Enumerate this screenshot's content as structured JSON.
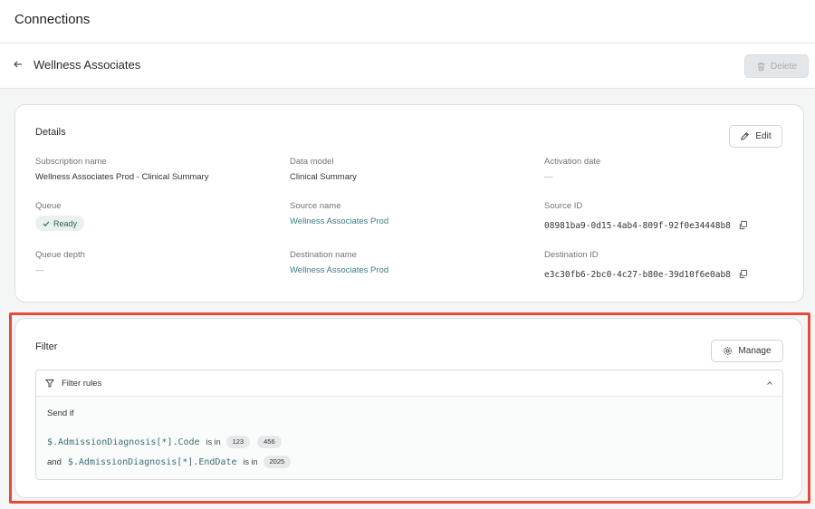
{
  "topbar": {
    "title": "Connections"
  },
  "header": {
    "name": "Wellness Associates",
    "delete_label": "Delete"
  },
  "details": {
    "title": "Details",
    "edit_label": "Edit",
    "subscription_name": {
      "label": "Subscription name",
      "value": "Wellness Associates Prod - Clinical Summary"
    },
    "data_model": {
      "label": "Data model",
      "value": "Clinical Summary"
    },
    "activation_date": {
      "label": "Activation date",
      "value": "—"
    },
    "queue": {
      "label": "Queue",
      "value": "Ready"
    },
    "source_name": {
      "label": "Source name",
      "value": "Wellness Associates Prod"
    },
    "source_id": {
      "label": "Source ID",
      "value": "08981ba9-0d15-4ab4-809f-92f0e34448b8"
    },
    "queue_depth": {
      "label": "Queue depth",
      "value": "—"
    },
    "destination_name": {
      "label": "Destination name",
      "value": "Wellness Associates Prod"
    },
    "destination_id": {
      "label": "Destination ID",
      "value": "e3c30fb6-2bc0-4c27-b80e-39d10f6e0ab8"
    }
  },
  "filter": {
    "title": "Filter",
    "manage_label": "Manage",
    "rules_title": "Filter rules",
    "send_if": "Send if",
    "rules": [
      {
        "prefix": "",
        "path": "$.AdmissionDiagnosis[*].Code",
        "op": "is in",
        "values": [
          "123",
          "456"
        ]
      },
      {
        "prefix": "and",
        "path": "$.AdmissionDiagnosis[*].EndDate",
        "op": "is in",
        "values": [
          "2025"
        ]
      }
    ]
  },
  "colors": {
    "highlight": "#e14d3a",
    "link": "#3a7e86",
    "ready_pill": "#e9f0ef"
  }
}
